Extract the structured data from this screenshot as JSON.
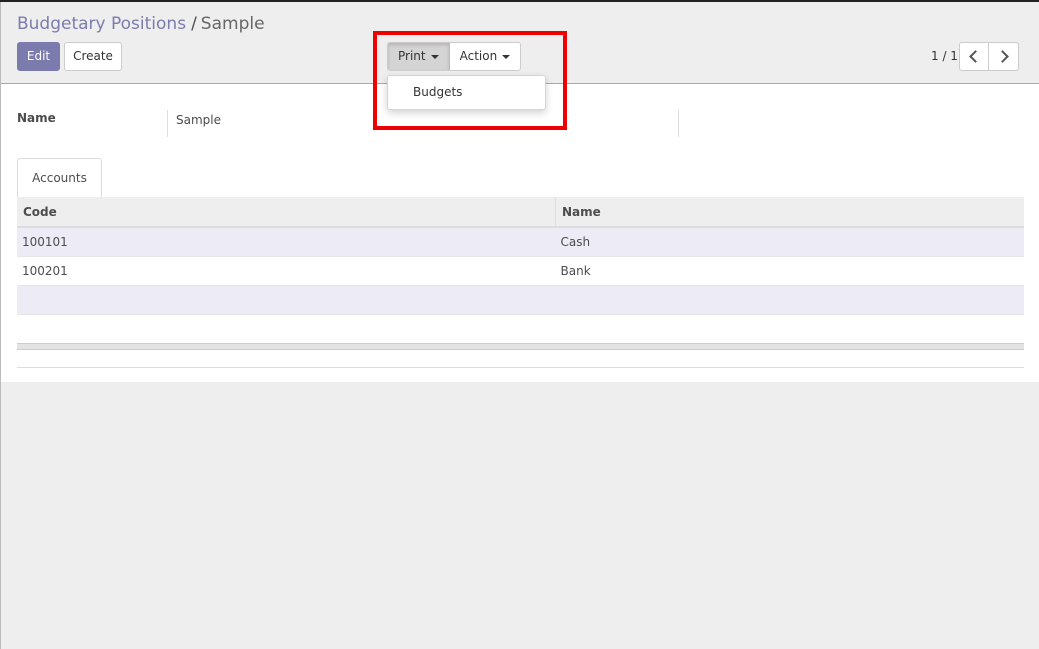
{
  "breadcrumb": {
    "parent": "Budgetary Positions",
    "separator": "/",
    "current": "Sample"
  },
  "toolbar": {
    "edit_label": "Edit",
    "create_label": "Create",
    "print_label": "Print",
    "action_label": "Action"
  },
  "print_menu": {
    "items": [
      "Budgets"
    ]
  },
  "pager": {
    "value": "1 / 1"
  },
  "form": {
    "name_label": "Name",
    "name_value": "Sample",
    "tab_label": "Accounts",
    "table": {
      "columns": [
        "Code",
        "Name"
      ],
      "rows": [
        {
          "code": "100101",
          "name": "Cash"
        },
        {
          "code": "100201",
          "name": "Bank"
        }
      ]
    }
  },
  "colors": {
    "accent": "#7c7bad",
    "highlight": "#ee0000",
    "row_alt": "#edecf6"
  }
}
